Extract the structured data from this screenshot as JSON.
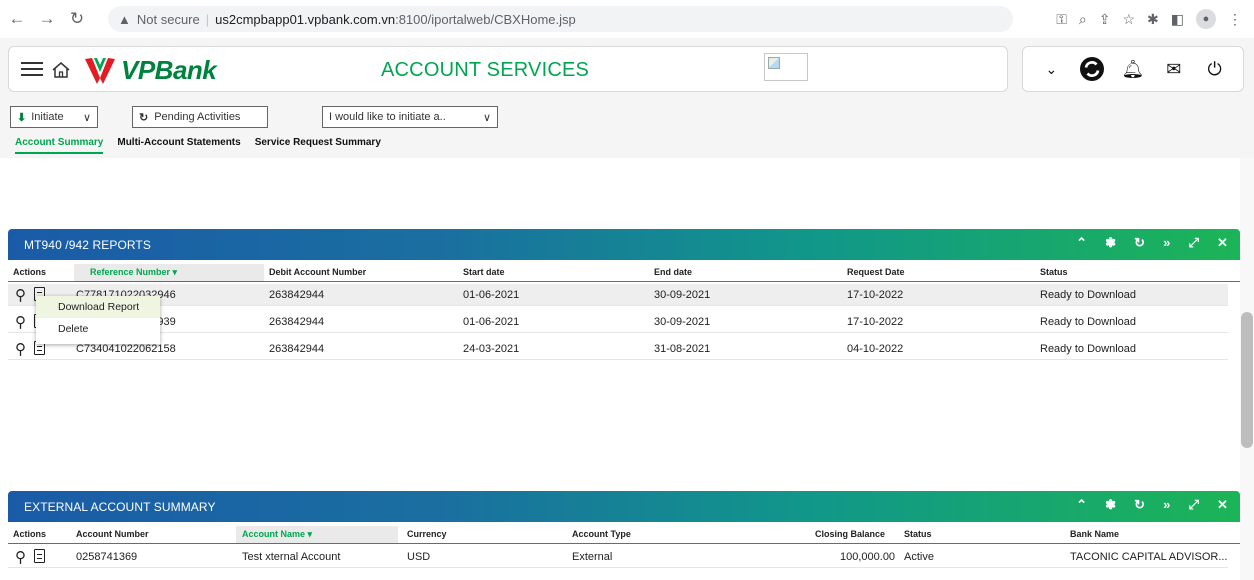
{
  "browser": {
    "not_secure": "Not secure",
    "url_host": "us2cmpbapp01.vpbank.com.vn",
    "url_path": ":8100/iportalweb/CBXHome.jsp"
  },
  "header": {
    "brand": "VPBank",
    "title": "ACCOUNT SERVICES"
  },
  "toolbar": {
    "initiate": "Initiate",
    "pending": "Pending Activities",
    "like": "I would like to initiate a.."
  },
  "tabs": [
    "Account Summary",
    "Multi-Account Statements",
    "Service Request Summary"
  ],
  "mt_panel": {
    "title": "MT940 /942 REPORTS",
    "columns": [
      "Actions",
      "Reference Number ▾",
      "Debit Account Number",
      "Start date",
      "End date",
      "Request Date",
      "Status"
    ],
    "rows": [
      {
        "ref": "C778171022032946",
        "debit": "263842944",
        "start": "01-06-2021",
        "end": "30-09-2021",
        "request": "17-10-2022",
        "status": "Ready to Download"
      },
      {
        "ref": "C778171022032939",
        "debit": "263842944",
        "start": "01-06-2021",
        "end": "30-09-2021",
        "request": "17-10-2022",
        "status": "Ready to Download"
      },
      {
        "ref": "C734041022062158",
        "debit": "263842944",
        "start": "24-03-2021",
        "end": "31-08-2021",
        "request": "04-10-2022",
        "status": "Ready to Download"
      }
    ],
    "context_menu": [
      "Download Report",
      "Delete"
    ]
  },
  "ext_panel": {
    "title": "EXTERNAL ACCOUNT SUMMARY",
    "columns": [
      "Actions",
      "Account Number",
      "Account Name ▾",
      "Currency",
      "Account Type",
      "Closing Balance",
      "Status",
      "Bank Name"
    ],
    "rows": [
      {
        "acct": "0258741369",
        "name": "Test xternal Account",
        "currency": "USD",
        "type": "External",
        "balance": "100,000.00",
        "status": "Active",
        "bank": "TACONIC CAPITAL ADVISOR..."
      }
    ]
  },
  "icons": {
    "panel_tools": [
      "chevron-up-icon",
      "gear-icon",
      "refresh-icon",
      "forward-icon",
      "expand-icon",
      "close-icon"
    ]
  },
  "colors": {
    "brand_green": "#00a651",
    "panel_gradient_start": "#1a5ba8",
    "panel_gradient_end": "#1cb457"
  }
}
